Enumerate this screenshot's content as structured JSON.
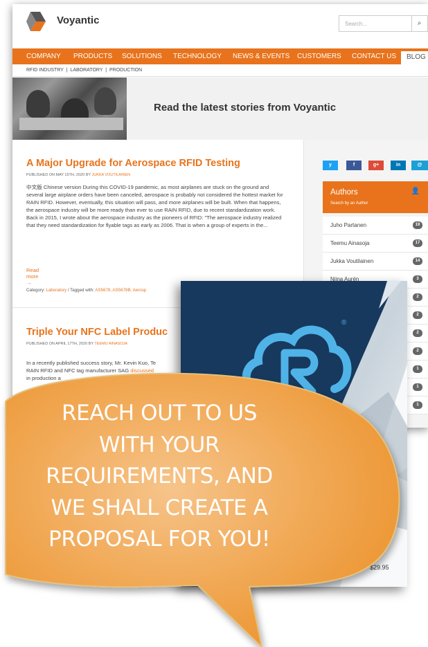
{
  "brand": {
    "name": "Voyantic",
    "accent": "#e8731c",
    "navy": "#17395d"
  },
  "search": {
    "placeholder": "Search..."
  },
  "nav": {
    "items": [
      "COMPANY",
      "PRODUCTS",
      "SOLUTIONS",
      "TECHNOLOGY",
      "NEWS & EVENTS",
      "CUSTOMERS",
      "CONTACT US"
    ],
    "active": "BLOG"
  },
  "subnav": {
    "items": [
      "RFID INDUSTRY",
      "LABORATORY",
      "PRODUCTION"
    ]
  },
  "hero": {
    "title": "Read the latest stories from Voyantic"
  },
  "posts": [
    {
      "title": "A Major Upgrade for Aerospace RFID Testing",
      "meta_prefix": "PUBLISHED ON MAY 15TH, 2020 BY ",
      "author": "JUKKA VOUTILAINEN",
      "excerpt": "中文版 Chinese version During this COVID-19 pandemic, as most airplanes are stuck on the ground and several large airplane orders have been canceled, aerospace is probably not considered the hottest market for RAIN RFID. However, eventually, this situation will pass, and more airplanes will be built. When that happens, the aerospace industry will be more ready than ever to use RAIN RFID, due to recent standardization work. Back in 2015, I wrote about the aerospace industry as the pioneers of RFID: \"The aerospace industry realized that they need standardization for flyable tags as early as 2006. That is when a group of experts in the...",
      "read_more": "Read more →",
      "category_label": "Category: ",
      "category": "Laboratory",
      "tagged_label": " / Tagged with: ",
      "tags": "AS5678, AS5678B, Aerosp"
    },
    {
      "title": "Triple Your NFC Label Produc",
      "meta_prefix": "PUBLISHED ON APRIL 17TH, 2020 BY ",
      "author": "TEEMU AINASOJA",
      "excerpt_start": "In a recently published success story, Mr. Kevin Kuo, Te",
      "excerpt_line2": "RAIN RFID and NFC tag manufacturer SAG ",
      "excerpt_link": "discussed",
      "excerpt_line3": "in production a"
    }
  ],
  "social": [
    "y",
    "f",
    "g+",
    "in",
    "@"
  ],
  "social_colors": [
    "#1da1f2",
    "#3b5998",
    "#dd4b39",
    "#0077b5",
    "#1ca0d6"
  ],
  "authors": {
    "title": "Authors",
    "subtitle": "Search by an Author",
    "list": [
      {
        "name": "Juho Partanen",
        "count": "19"
      },
      {
        "name": "Teemu Ainasoja",
        "count": "17"
      },
      {
        "name": "Jukka Voutilainen",
        "count": "14"
      },
      {
        "name": "Niina Aurén",
        "count": "3"
      }
    ],
    "hidden_counts": [
      "2",
      "2",
      "2",
      "2",
      "1",
      "1",
      "1"
    ]
  },
  "product": {
    "price": "$29.95",
    "trademark": "®",
    "icon": "rfid-cloud-icon"
  },
  "callout": {
    "lines": [
      "REACH OUT TO US",
      "WITH YOUR",
      "REQUIREMENTS, AND",
      "WE SHALL CREATE A",
      "PROPOSAL FOR YOU!"
    ],
    "fill": "#f0a640"
  }
}
